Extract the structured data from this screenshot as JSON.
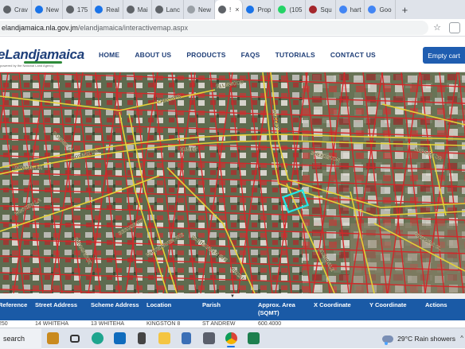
{
  "browser": {
    "tabs": [
      {
        "label": "Crav",
        "color": "#5f6368"
      },
      {
        "label": "New",
        "color": "#1a73e8"
      },
      {
        "label": "175",
        "color": "#5f6368"
      },
      {
        "label": "Real",
        "color": "#1a73e8"
      },
      {
        "label": "Mai",
        "color": "#5f6368"
      },
      {
        "label": "Lanc",
        "color": "#5f6368"
      },
      {
        "label": "New",
        "color": "#9aa0a6"
      },
      {
        "label": "!",
        "color": "#5f6368",
        "active": true
      },
      {
        "label": "Prop",
        "color": "#1a73e8"
      },
      {
        "label": "(105",
        "color": "#25d366"
      },
      {
        "label": "Squ",
        "color": "#a4262c"
      },
      {
        "label": "hart",
        "color": "#4285f4"
      },
      {
        "label": "Goo",
        "color": "#4285f4"
      }
    ],
    "new_tab_label": "+",
    "close_label": "×",
    "url_host": "elandjamaica.nla.gov.jm",
    "url_path": "/elandjamaica/interactivemap.aspx",
    "bookmark_glyph": "☆"
  },
  "site": {
    "brand": "eLandjamaica",
    "tagline": "powered by the National Land Agency",
    "nav": [
      "HOME",
      "ABOUT US",
      "PRODUCTS",
      "FAQS",
      "TUTORIALS",
      "CONTACT US"
    ],
    "cart_button": "Empty cart"
  },
  "map": {
    "street_labels": [
      "CHRISTER",
      "DOWNIE DR",
      "DOWNIE CL",
      "BULLEY",
      "ELLEWOOD",
      "DOWNIE DR",
      "EUMRE",
      "SHEERSTON",
      "WINVIEW LA",
      "BRUNSWICK",
      "BEAUSE RD",
      "WHITEHAVEN AVE",
      "WHITEHAVEN AVE",
      "GLENDALE",
      "VICTORIA CL",
      "BROUSE DR",
      "BREST"
    ],
    "collapse_glyph": "▼"
  },
  "table": {
    "headers": [
      "Reference",
      "Street Address",
      "Scheme Address",
      "Location",
      "Parish",
      "Approx. Area\n(SQMT)",
      "X Coordinate",
      "Y Coordinate",
      "Actions"
    ],
    "peek_row": [
      "250",
      "14 WHITEHA",
      "13 WHITEHA",
      "KINGSTON 8",
      "ST ANDREW",
      "600.4000",
      "",
      "",
      ""
    ]
  },
  "taskbar": {
    "search_label": "search",
    "icons": [
      "briefcase-icon",
      "task-view-icon",
      "edge-icon",
      "outlook-icon",
      "notes-icon",
      "explorer-icon",
      "calculator-icon",
      "store-icon",
      "chrome-icon",
      "project-icon"
    ],
    "weather": "29°C Rain showers",
    "caret": "^"
  },
  "colors": {
    "brand_blue": "#1f3e77",
    "button_blue": "#1f5db0",
    "table_header": "#1a5aa6",
    "parcel_line": "#d2282a",
    "road_line": "#e4d236",
    "selected_parcel": "#22e8e8"
  }
}
